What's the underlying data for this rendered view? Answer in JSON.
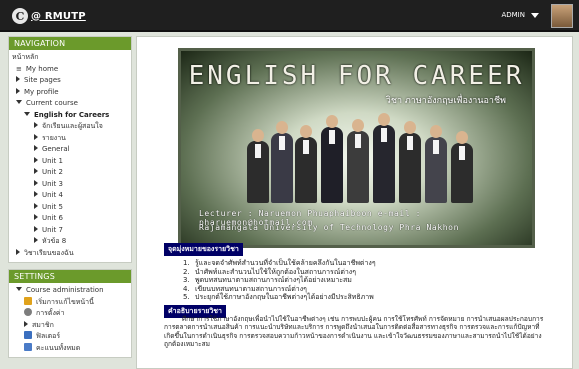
{
  "header": {
    "logo_text": "@ RMUTP",
    "user_name": "ADMIN"
  },
  "navigation": {
    "title": "NAVIGATION",
    "home": "หน้าหลัก",
    "my_home": "My home",
    "site_pages": "Site pages",
    "my_profile": "My profile",
    "current_course": "Current course",
    "course_name": "English for Careers",
    "course_items": [
      "จักเรียนและผู้สอนใจ",
      "รายงาน",
      "General",
      "Unit 1",
      "Unit 2",
      "Unit 3",
      "Unit 4",
      "Unit 5",
      "Unit 6",
      "Unit 7",
      "หัวข้อ 8"
    ],
    "my_courses": "วิชาเรียนของฉัน"
  },
  "settings": {
    "title": "SETTINGS",
    "course_admin": "Course administration",
    "items": [
      "เริ่มการแก้ไขหน้านี้",
      "การตั้งค่า",
      "สมาชิก",
      "ฟิลเตอร์",
      "คะแนนทั้งหมด"
    ]
  },
  "banner": {
    "title": "ENGLISH FOR CAREER",
    "subtitle": "วิชา ภาษาอังกฤษเพื่องานอาชีพ",
    "lecturer": "Lecturer : Naruemon Phuaphaiboon e-mail : pharuemon@hotmail.com",
    "university": "Rajamangala University of Technology Phra Nakhon"
  },
  "goals": {
    "heading": "จุดมุ่งหมายของรายวิชา",
    "items": [
      "รู้และจดจำศัพท์สำนวนที่จำเป็นใช้คล้ายคลึงกันในอาชีพต่างๆ",
      "นำศัพท์และสำนวนไปใช้ให้ถูกต้องในสถานการณ์ต่างๆ",
      "พูดบทสนทนาตามสถานการณ์ต่างๆได้อย่างเหมาะสม",
      "เขียนบทสนทนาตามสถานการณ์ต่างๆ",
      "ประยุกต์ใช้ภาษาอังกฤษในอาชีพต่างๆได้อย่างมีประสิทธิภาพ"
    ]
  },
  "description": {
    "heading": "คำอธิบายรายวิชา",
    "text": "ศึกษาการใช้ภาษาอังกฤษเพื่อนำไปใช้ในอาชีพต่างๆ เช่น การพบปะผู้คน การใช้โทรศัพท์ การจัดหมาย การนำเสนอผลประกอบการ การตลาดการนำเสนอสินค้า การแนะนำบริษัทและบริการ การพูดถึงนำเสนอในการติดต่อสื่อสารทางธุรกิจ การตรวจและการแก้ปัญหาที่เกิดขึ้นในการดำเนินธุรกิจ การตรวจสอบความก้าวหน้าของการดำเนินงาน และเข้าใจวัฒนธรรมของภาษาและสามารถนำไปใช้ได้อย่างถูกต้องเหมาะสม"
  },
  "colors": {
    "block_header": "#6b9a2b",
    "section_heading_bg": "#000066",
    "topbar": "#1f1f1f"
  }
}
